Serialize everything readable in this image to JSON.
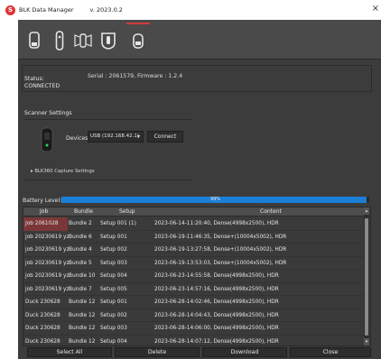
{
  "titlebar": {
    "app_title": "BLK Data Manager",
    "version": "v. 2023.0.2",
    "close_glyph": "×",
    "logo_letter": "S"
  },
  "toolbar": {
    "icons": [
      "scanner-device-icon",
      "scanner-slim-icon",
      "scanner-wings-icon",
      "shield-scanner-icon",
      "scanner-small-icon"
    ],
    "accent_color": "#d23c3c"
  },
  "status": {
    "label": "Status:",
    "value": "CONNECTED",
    "serial": "Serial : 2061579, Firmware : 1.2.4"
  },
  "scanner_settings": {
    "label": "Scanner Settings",
    "devices_label": "Devices:",
    "device_selected": "USB (192.168.42.1)",
    "connect_label": "Connect",
    "capture_settings_label": "▸  BLK360 Capture Settings"
  },
  "battery": {
    "label": "Battery Level:",
    "percent_text": "99%",
    "level_fraction": 0.99,
    "fill_color": "#1c7fd6"
  },
  "table": {
    "headers": [
      "Job",
      "Bundle",
      "Setup",
      "Content"
    ],
    "rows": [
      {
        "job": "Job 2061028",
        "bundle": "Bundle 2",
        "setup": "Setup 001 (1)",
        "content": "2023-06-14-11:20:40, Dense(4998x2500), HDR"
      },
      {
        "job": "job 20230619 yz",
        "bundle": "Bundle 6",
        "setup": "Setup 001",
        "content": "2023-06-19-11:46:35, Dense+(10004x5002), HDR"
      },
      {
        "job": "job 20230619 yz",
        "bundle": "Bundle 4",
        "setup": "Setup 002",
        "content": "2023-06-19-13:27:58, Dense+(10004x5002), HDR"
      },
      {
        "job": "job 20230619 yz",
        "bundle": "Bundle 5",
        "setup": "Setup 003",
        "content": "2023-06-19-13:53:03, Dense+(10004x5002), HDR"
      },
      {
        "job": "job 20230619 yz",
        "bundle": "Bundle 10",
        "setup": "Setup 004",
        "content": "2023-06-23-14:55:58, Dense(4998x2500), HDR"
      },
      {
        "job": "job 20230619 yz",
        "bundle": "Bundle 7",
        "setup": "Setup 005",
        "content": "2023-06-23-14:57:16, Dense(4998x2500), HDR"
      },
      {
        "job": "Duck 230628",
        "bundle": "Bundle 12",
        "setup": "Setup 001",
        "content": "2023-06-28-14:02:46, Dense(4998x2500), HDR"
      },
      {
        "job": "Duck 230628",
        "bundle": "Bundle 12",
        "setup": "Setup 002",
        "content": "2023-06-28-14:04:43, Dense(4998x2500), HDR"
      },
      {
        "job": "Duck 230628",
        "bundle": "Bundle 12",
        "setup": "Setup 003",
        "content": "2023-06-28-14:06:00, Dense(4998x2500), HDR"
      },
      {
        "job": "Duck 230628",
        "bundle": "Bundle 12",
        "setup": "Setup 004",
        "content": "2023-06-28-14:07:12, Dense(4998x2500), HDR"
      }
    ],
    "selected_row": 0,
    "selected_color": "#7b3737"
  },
  "footer": {
    "select_all": "Select All",
    "delete": "Delete",
    "download": "Download",
    "close": "Close"
  }
}
